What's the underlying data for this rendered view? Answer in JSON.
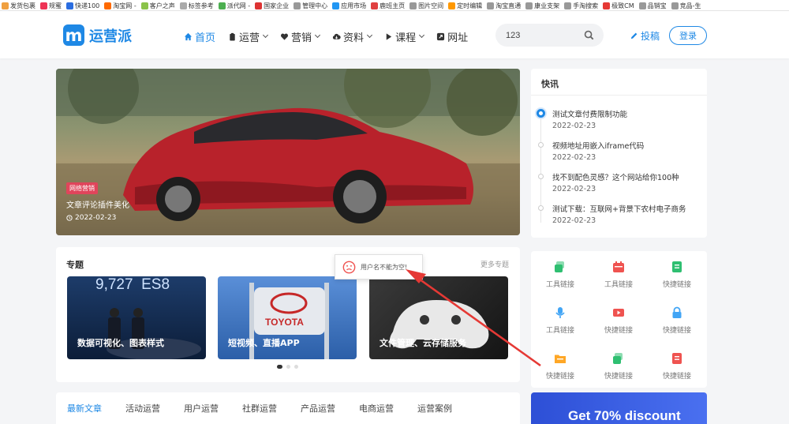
{
  "bookmarks": [
    {
      "label": "发货包裹",
      "color": "#f0a040"
    },
    {
      "label": "规蜜",
      "color": "#e35"
    },
    {
      "label": "快递100",
      "color": "#2a6de0"
    },
    {
      "label": "淘宝网 -",
      "color": "#ff6a00"
    },
    {
      "label": "客户之声",
      "color": "#8bc34a"
    },
    {
      "label": "标签参考",
      "color": "#aaa"
    },
    {
      "label": "派代网 -",
      "color": "#4caf50"
    },
    {
      "label": "国家企业",
      "color": "#d33"
    },
    {
      "label": "管理中心",
      "color": "#999"
    },
    {
      "label": "应用市场",
      "color": "#2196f3"
    },
    {
      "label": "鹿班主页",
      "color": "#e04040"
    },
    {
      "label": "图片空间",
      "color": "#999"
    },
    {
      "label": "定时编辑",
      "color": "#ff9800"
    },
    {
      "label": "淘宝直通",
      "color": "#999"
    },
    {
      "label": "康业支架",
      "color": "#999"
    },
    {
      "label": "手淘搜索",
      "color": "#999"
    },
    {
      "label": "极致CM",
      "color": "#e53935"
    },
    {
      "label": "品销宝",
      "color": "#999"
    },
    {
      "label": "竞品-生",
      "color": "#999"
    }
  ],
  "brand": {
    "mark": "m",
    "name": "运营派"
  },
  "nav": [
    {
      "label": "首页",
      "icon": "home-icon",
      "active": true
    },
    {
      "label": "运营",
      "icon": "clipboard-icon",
      "caret": true
    },
    {
      "label": "营销",
      "icon": "heart-icon",
      "caret": true
    },
    {
      "label": "资料",
      "icon": "cloud-download-icon",
      "caret": true
    },
    {
      "label": "课程",
      "icon": "play-icon",
      "caret": true
    },
    {
      "label": "网址",
      "icon": "link-icon"
    }
  ],
  "search": {
    "value": "123",
    "icon": "search-icon"
  },
  "post_label": "投稿",
  "login_label": "登录",
  "hero": {
    "tag": "网络营销",
    "title": "文章评论插件美化",
    "date": "2022-02-23"
  },
  "news": {
    "title": "快讯",
    "items": [
      {
        "text": "测试文章付费限制功能",
        "date": "2022-02-23"
      },
      {
        "text": "视频地址用嵌入iframe代码",
        "date": "2022-02-23"
      },
      {
        "text": "找不到配色灵感？这个网站给你100种",
        "date": "2022-02-23"
      },
      {
        "text": "测试下载：互联网+背景下农村电子商务",
        "date": "2022-02-23"
      }
    ]
  },
  "topics": {
    "title": "专题",
    "more": "更多专题",
    "cards": [
      {
        "label": "数据可视化、图表样式",
        "banner": "9,727  ES8"
      },
      {
        "label": "短视频、直播APP",
        "banner": "TOYOTA"
      },
      {
        "label": "文件管理、云存储服务"
      }
    ]
  },
  "toast": {
    "text": "用户名不能为空!",
    "icon": "sad-face-icon"
  },
  "quick_links": [
    {
      "label": "工具链接",
      "color": "#2fbf71",
      "icon": "layers-icon"
    },
    {
      "label": "工具链接",
      "color": "#ef5350",
      "icon": "calendar-icon"
    },
    {
      "label": "快捷链接",
      "color": "#2fbf71",
      "icon": "document-icon"
    },
    {
      "label": "工具链接",
      "color": "#42a5f5",
      "icon": "microphone-icon"
    },
    {
      "label": "快捷链接",
      "color": "#ef5350",
      "icon": "video-icon"
    },
    {
      "label": "快捷链接",
      "color": "#42a5f5",
      "icon": "lock-icon"
    },
    {
      "label": "快捷链接",
      "color": "#ffa726",
      "icon": "folder-icon"
    },
    {
      "label": "快捷链接",
      "color": "#2fbf71",
      "icon": "layers-icon"
    },
    {
      "label": "快捷链接",
      "color": "#ef5350",
      "icon": "document-icon"
    }
  ],
  "tabs": [
    "最新文章",
    "活动运营",
    "用户运营",
    "社群运营",
    "产品运营",
    "电商运营",
    "运营案例"
  ],
  "promo": {
    "text": "Get 70% discount"
  },
  "colors": {
    "accent": "#1e88e5",
    "tag": "#e0455b",
    "annotation_arrow": "#e53935"
  }
}
